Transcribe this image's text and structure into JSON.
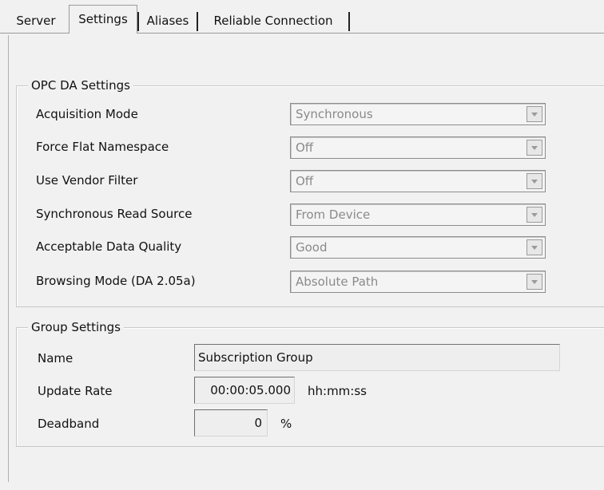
{
  "tabs": [
    {
      "label": "Server",
      "active": false
    },
    {
      "label": "Settings",
      "active": true
    },
    {
      "label": "Aliases",
      "active": false
    },
    {
      "label": "Reliable Connection",
      "active": false
    }
  ],
  "opc_da_settings": {
    "title": "OPC DA Settings",
    "rows": [
      {
        "label": "Acquisition Mode",
        "value": "Synchronous"
      },
      {
        "label": "Force Flat Namespace",
        "value": "Off"
      },
      {
        "label": "Use Vendor Filter",
        "value": "Off"
      },
      {
        "label": "Synchronous Read Source",
        "value": "From Device"
      },
      {
        "label": "Acceptable Data Quality",
        "value": "Good"
      },
      {
        "label": "Browsing Mode (DA 2.05a)",
        "value": "Absolute Path"
      }
    ]
  },
  "group_settings": {
    "title": "Group Settings",
    "name": {
      "label": "Name",
      "value": "Subscription Group"
    },
    "update_rate": {
      "label": "Update Rate",
      "value": "00:00:05.000",
      "unit": "hh:mm:ss"
    },
    "deadband": {
      "label": "Deadband",
      "value": "0",
      "unit": "%"
    }
  }
}
